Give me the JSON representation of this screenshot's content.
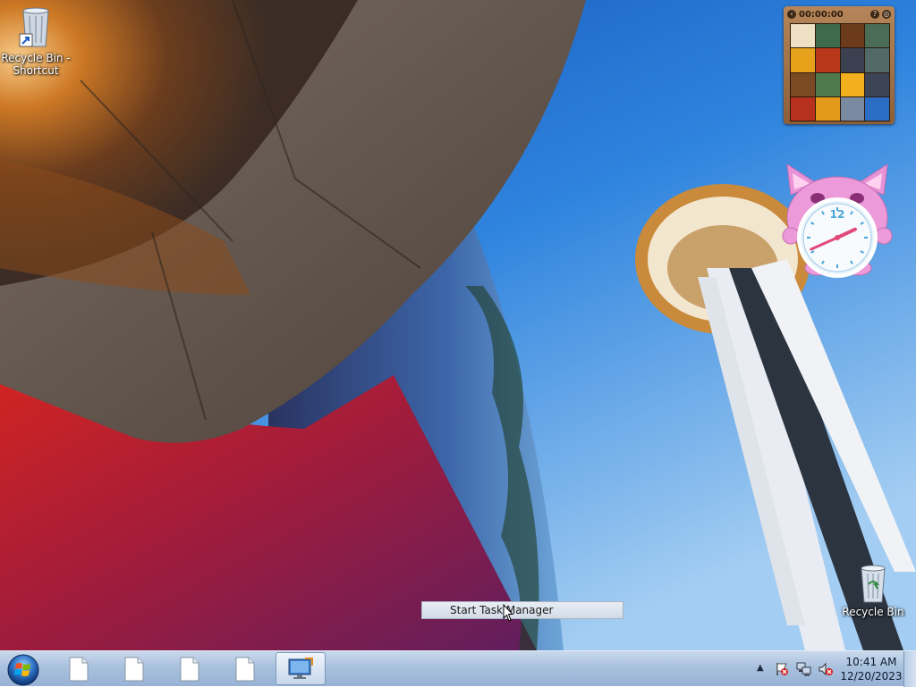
{
  "desktop": {
    "icons": [
      {
        "label": "Recycle Bin - Shortcut",
        "icon": "recycle-bin-shortcut-icon"
      },
      {
        "label": "Recycle Bin",
        "icon": "recycle-bin-icon"
      }
    ]
  },
  "gadgets": {
    "puzzle": {
      "timer": "00:00:00",
      "buttons": {
        "left": "‹",
        "help": "?",
        "shuffle": "◎"
      },
      "tiles": [
        "#efe2c4",
        "#3e6b4b",
        "#6b3b1c",
        "#4b6d57",
        "#e7a21b",
        "#b8381c",
        "#3b4150",
        "#526a67",
        "#7a4a24",
        "#4f7a4d",
        "#f2b01e",
        "#3c4455",
        "#b8301e",
        "#e39a1a",
        "#7a8aa0",
        "#2b6cc4"
      ]
    },
    "clock": {
      "numeral": "12",
      "hour_hand_angle": 65,
      "minute_hand_angle": 246
    }
  },
  "context_menu": {
    "item": "Start Task Manager"
  },
  "taskbar": {
    "buttons": [
      "document-icon",
      "document-icon",
      "document-icon",
      "document-icon",
      "remote-desktop-icon"
    ],
    "tray": {
      "overflow": "▲",
      "icons": [
        "action-center-flag-icon",
        "network-icon",
        "volume-muted-icon"
      ],
      "time": "10:41 AM",
      "date": "12/20/2023"
    }
  }
}
